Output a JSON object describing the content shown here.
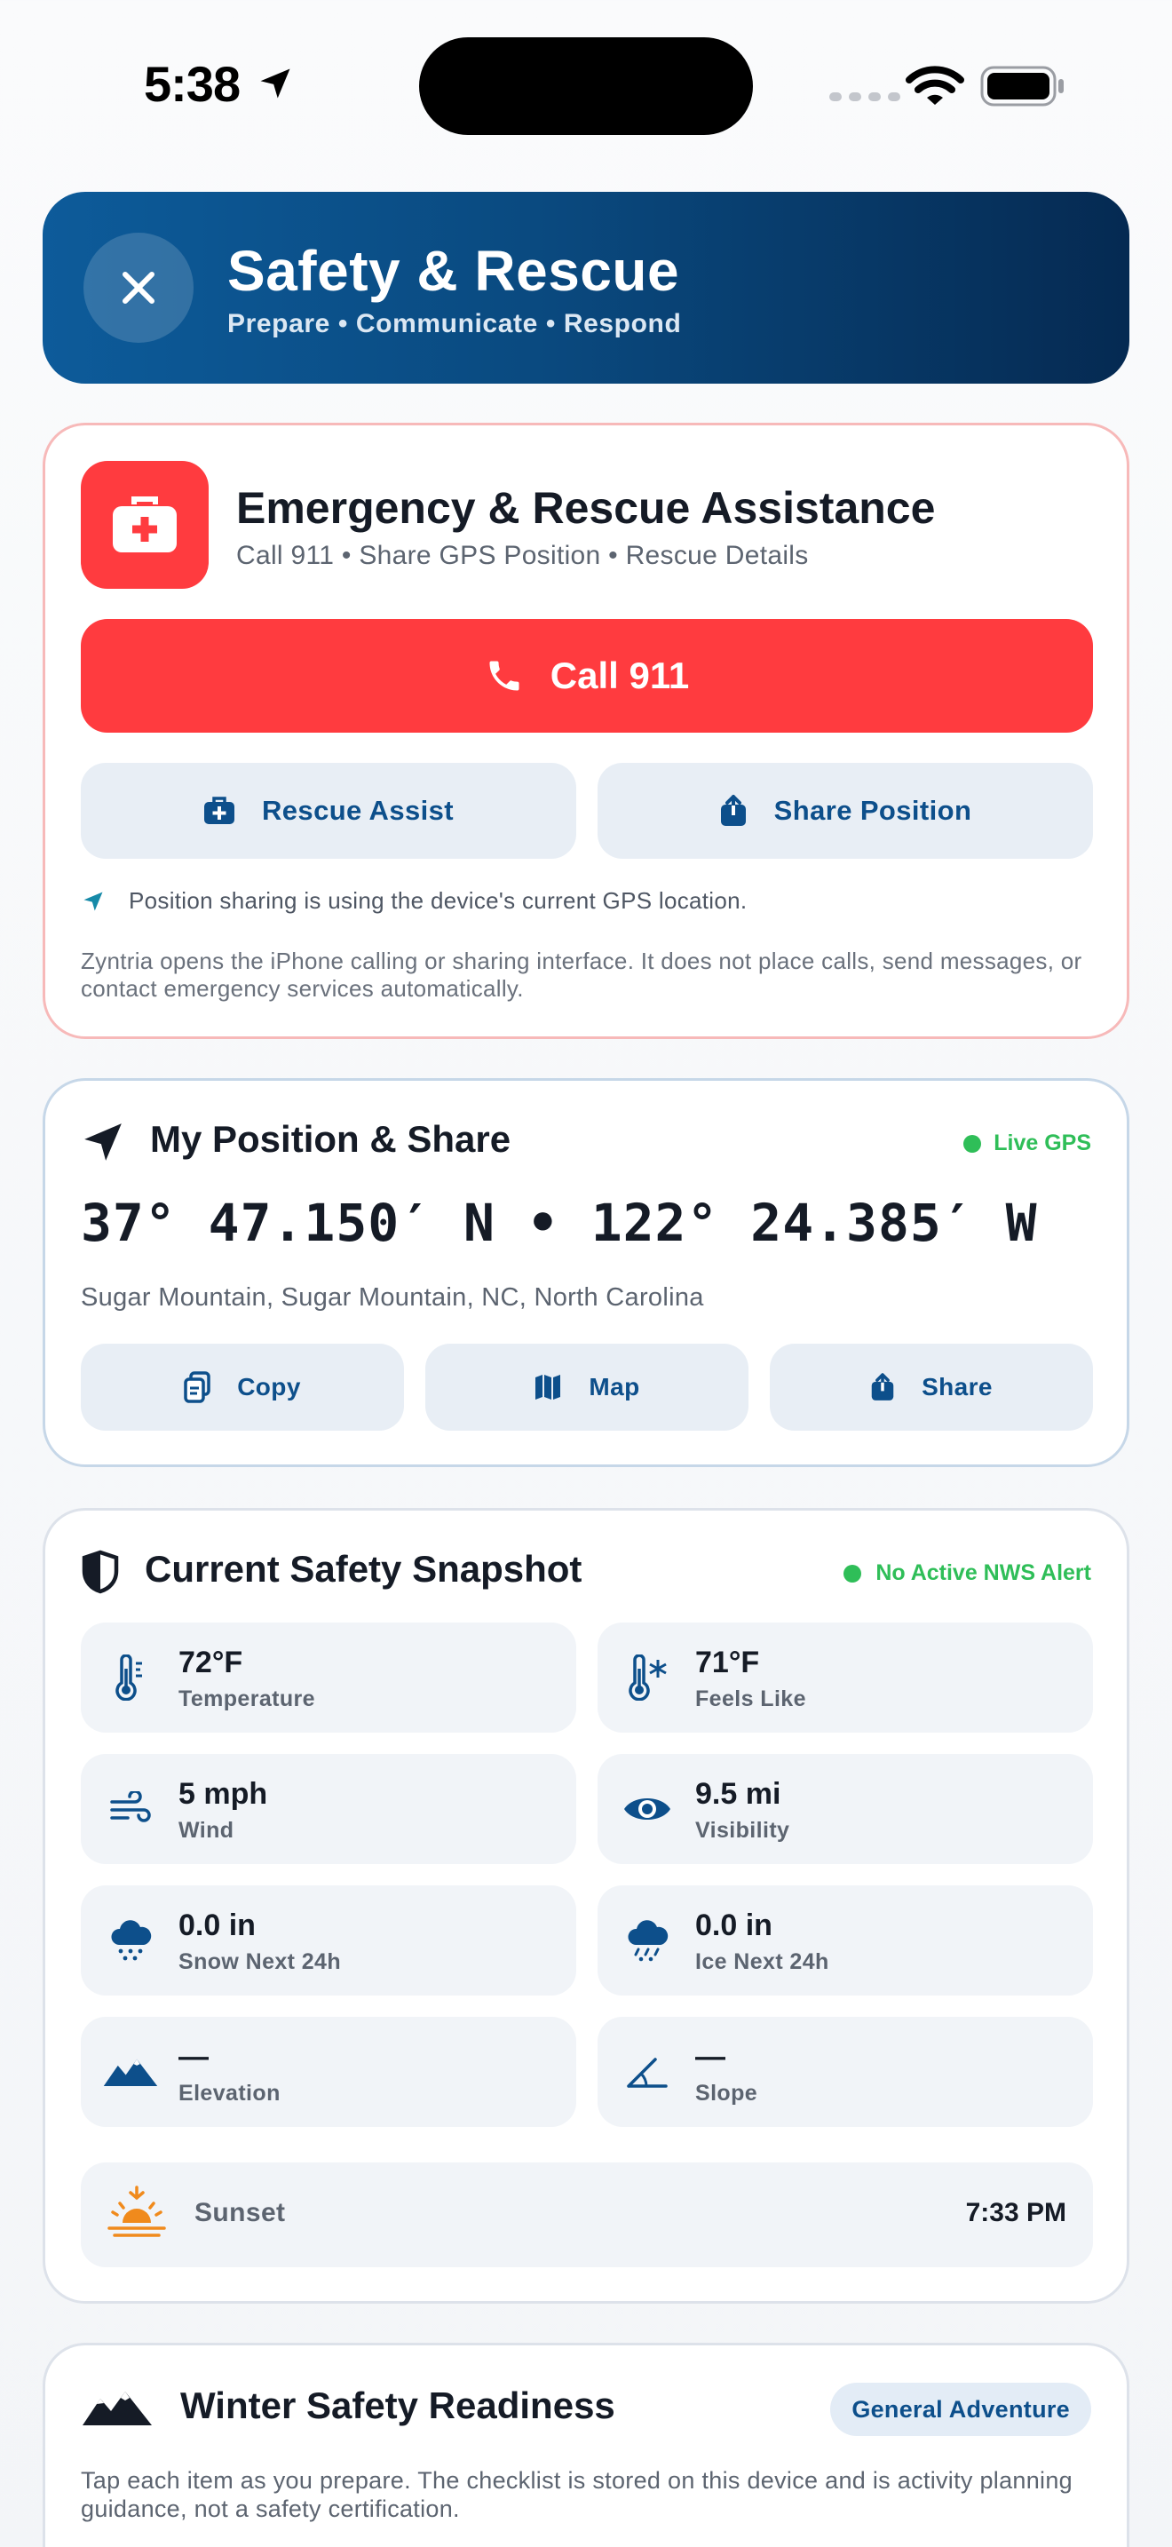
{
  "status_bar": {
    "time": "5:38"
  },
  "header": {
    "title": "Safety & Rescue",
    "subtitle": "Prepare • Communicate • Respond"
  },
  "emergency": {
    "title": "Emergency & Rescue Assistance",
    "subtitle": "Call 911 • Share GPS Position • Rescue Details",
    "call_label": "Call 911",
    "rescue_label": "Rescue Assist",
    "share_label": "Share Position",
    "gps_note": "Position sharing is using the device's current GPS location.",
    "disclaimer": "Zyntria opens the iPhone calling or sharing interface. It does not place calls, send messages, or contact emergency services automatically."
  },
  "position": {
    "title": "My Position & Share",
    "badge": "Live GPS",
    "coordinates": "37° 47.150′ N • 122° 24.385′ W",
    "place": "Sugar Mountain, Sugar Mountain, NC, North Carolina",
    "buttons": {
      "copy": "Copy",
      "map": "Map",
      "share": "Share"
    }
  },
  "snapshot": {
    "title": "Current Safety Snapshot",
    "badge": "No Active NWS Alert",
    "tiles": [
      {
        "value": "72°F",
        "label": "Temperature",
        "icon": "thermometer-icon"
      },
      {
        "value": "71°F",
        "label": "Feels Like",
        "icon": "thermometer-snowflake-icon"
      },
      {
        "value": "5 mph",
        "label": "Wind",
        "icon": "wind-icon"
      },
      {
        "value": "9.5 mi",
        "label": "Visibility",
        "icon": "eye-icon"
      },
      {
        "value": "0.0 in",
        "label": "Snow Next 24h",
        "icon": "cloud-snow-icon"
      },
      {
        "value": "0.0 in",
        "label": "Ice Next 24h",
        "icon": "cloud-sleet-icon"
      },
      {
        "value": "—",
        "label": "Elevation",
        "icon": "mountains-icon"
      },
      {
        "value": "—",
        "label": "Slope",
        "icon": "angle-icon"
      }
    ],
    "sunset": {
      "label": "Sunset",
      "value": "7:33 PM"
    }
  },
  "winter": {
    "title": "Winter Safety Readiness",
    "badge": "General Adventure",
    "description": "Tap each item as you prepare. The checklist is stored on this device and is activity planning guidance, not a safety certification."
  },
  "colors": {
    "emergency_red": "#ff3b3f",
    "brand_blue": "#0d4f8b",
    "live_green": "#2fbe58"
  }
}
